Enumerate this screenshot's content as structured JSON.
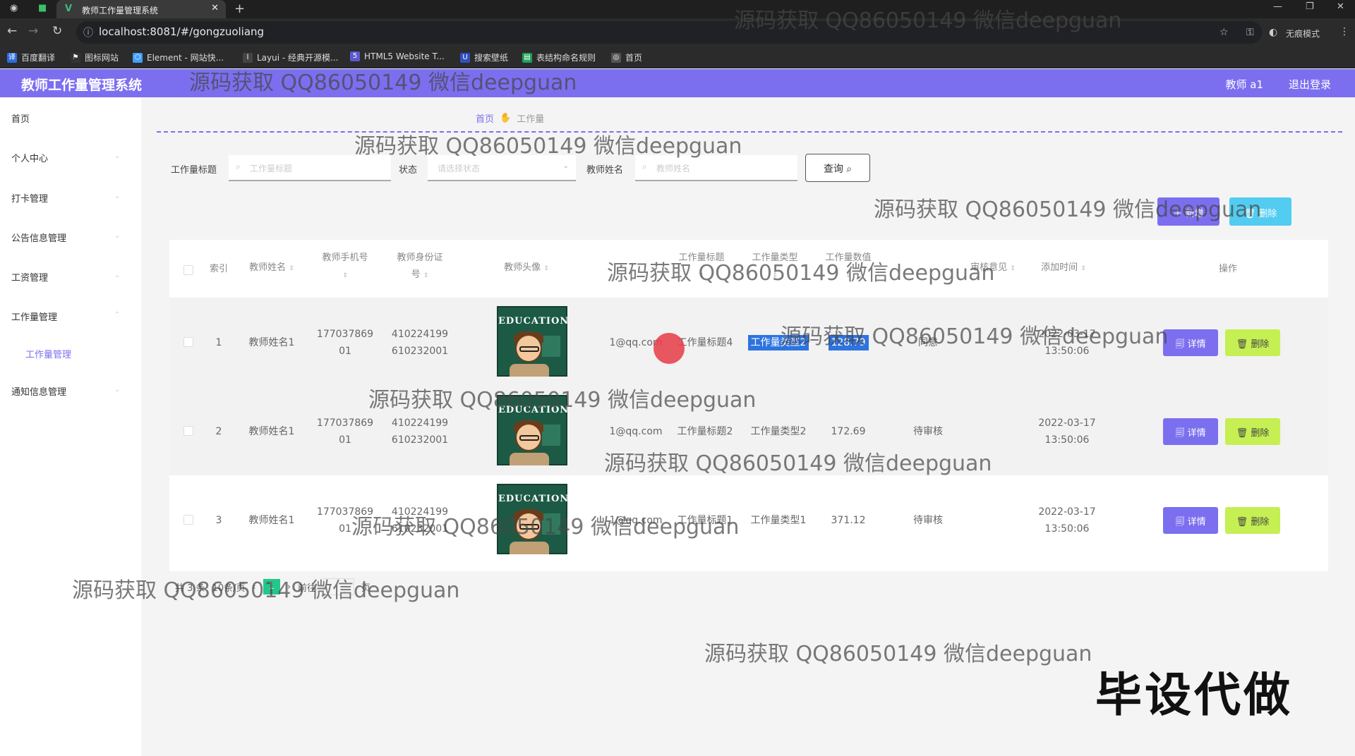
{
  "browser": {
    "tab_title": "教师工作量管理系统",
    "url": "localhost:8081/#/gongzuoliang",
    "profile": "无痕模式",
    "bookmarks": [
      "百度翻译",
      "图标网站",
      "Element - 网站快...",
      "Layui - 经典开源模...",
      "HTML5 Website T...",
      "搜索壁纸",
      "表结构命名规则",
      "首页"
    ]
  },
  "header": {
    "title": "教师工作量管理系统",
    "user": "教师 a1",
    "logout": "退出登录"
  },
  "sidebar": {
    "items": [
      "首页",
      "个人中心",
      "打卡管理",
      "公告信息管理",
      "工资管理",
      "工作量管理",
      "通知信息管理"
    ],
    "sub_item": "工作量管理"
  },
  "breadcrumb": {
    "home": "首页",
    "current": "工作量"
  },
  "filters": {
    "title_label": "工作量标题",
    "title_placeholder": "工作量标题",
    "status_label": "状态",
    "status_placeholder": "请选择状态",
    "teacher_label": "教师姓名",
    "teacher_placeholder": "教师姓名",
    "query_button": "查询"
  },
  "actions": {
    "add": "新增",
    "delete": "删除"
  },
  "table": {
    "headers": {
      "index": "索引",
      "name": "教师姓名",
      "phone_a": "教师手机号",
      "idcard_a": "教师身份证",
      "idcard_b": "号",
      "avatar": "教师头像",
      "title": "工作量标题",
      "type": "工作量类型",
      "value": "工作量数值",
      "review": "审核意见",
      "added": "添加时间",
      "op": "操作"
    },
    "rows": [
      {
        "index": "1",
        "name": "教师姓名1",
        "phone_a": "177037869",
        "phone_b": "01",
        "id_a": "410224199",
        "id_b": "610232001",
        "email": "1@qq.com",
        "title": "工作量标题4",
        "type": "工作量类型2",
        "value": "128.79",
        "review": "同意",
        "date": "2022-03-17",
        "time": "13:50:06"
      },
      {
        "index": "2",
        "name": "教师姓名1",
        "phone_a": "177037869",
        "phone_b": "01",
        "id_a": "410224199",
        "id_b": "610232001",
        "email": "1@qq.com",
        "title": "工作量标题2",
        "type": "工作量类型2",
        "value": "172.69",
        "review": "待审核",
        "date": "2022-03-17",
        "time": "13:50:06"
      },
      {
        "index": "3",
        "name": "教师姓名1",
        "phone_a": "177037869",
        "phone_b": "01",
        "id_a": "410224199",
        "id_b": "610232001",
        "email": "1@qq.com",
        "title": "工作量标题1",
        "type": "工作量类型1",
        "value": "371.12",
        "review": "待审核",
        "date": "2022-03-17",
        "time": "13:50:06"
      }
    ],
    "detail_btn": "详情",
    "delete_btn": "删除",
    "avatar_text": "EDUCATION"
  },
  "pagination": {
    "total": "共 3 条",
    "page_size": "10条/页",
    "current": "1",
    "goto": "前往",
    "page_unit": "页"
  },
  "watermark": "源码获取 QQ86050149 微信deepguan",
  "stamp": "毕设代做",
  "colors": {
    "accent": "#7b6ff0",
    "info": "#52ccf0",
    "lime": "#c5ef52",
    "tag": "#2e74e0"
  }
}
